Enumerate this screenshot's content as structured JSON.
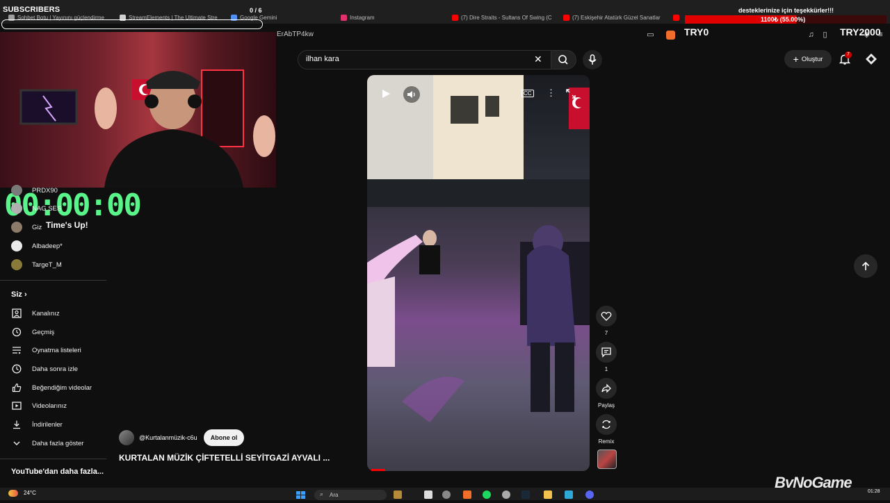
{
  "browser": {
    "tabs": [
      {
        "label": "Sohbet Botu | Yayınını güçlendirme",
        "color": "#9e9e9e"
      },
      {
        "label": "StreamElements | The Ultimate Stre",
        "color": "#cfcfcf"
      },
      {
        "label": "Google Gemini",
        "color": "#4f8ff7"
      },
      {
        "label": "Instagram",
        "color": "#e1306c"
      },
      {
        "label": "(7) Dire Straits - Sultans Of Swing (C",
        "color": "#ff0000"
      },
      {
        "label": "(7) Eskişehir Atatürk Güzel Sanatlar",
        "color": "#ff0000"
      },
      {
        "label": "",
        "color": "#ff0000"
      }
    ],
    "url_fragment": "ErAbTP4kw"
  },
  "overlays": {
    "subscribers_label": "SUBSCRIBERS",
    "subscribers_count": "0 / 6",
    "subscribers_progress": 0,
    "donation_message": "desteklerinize için teşekkürler!!!",
    "donation_amount": "1100₺ (55.00%)",
    "donation_progress": 0.55,
    "goal_start": "TRY0",
    "goal_end": "TRY2000",
    "timer": "00:00:00",
    "timer_message": "Time's Up!"
  },
  "sidebar": {
    "subscriptions": [
      {
        "label": "PRDX90",
        "color": "#7a7a7a"
      },
      {
        "label": "NAG SES",
        "color": "#b0b0b0"
      },
      {
        "label": "Giz",
        "color": "#8d7b6a"
      },
      {
        "label": "Albadeep*",
        "color": "#e9e9e9"
      },
      {
        "label": "TargeT_M",
        "color": "#8a7a3a"
      }
    ],
    "you_heading": "Siz",
    "you_items": [
      {
        "label": "Kanalınız",
        "icon": "channel-icon"
      },
      {
        "label": "Geçmiş",
        "icon": "history-icon"
      },
      {
        "label": "Oynatma listeleri",
        "icon": "playlist-icon"
      },
      {
        "label": "Daha sonra izle",
        "icon": "clock-icon"
      },
      {
        "label": "Beğendiğim videolar",
        "icon": "thumbs-up-icon"
      },
      {
        "label": "Videolarınız",
        "icon": "video-icon"
      },
      {
        "label": "İndirilenler",
        "icon": "download-icon"
      },
      {
        "label": "Daha fazla göster",
        "icon": "chevron-down-icon"
      }
    ],
    "more_heading": "YouTube'dan daha fazla..."
  },
  "header": {
    "search_value": "ilhan kara",
    "create_label": "Oluştur",
    "notification_count": "7"
  },
  "short": {
    "channel": "@Kurtalanmüzik-c6u",
    "subscribe_label": "Abone ol",
    "title": "KURTALAN MÜZİK ÇİFTETELLİ SEYİTGAZİ AYVALI ...",
    "like_count": "7",
    "comment_count": "1",
    "share_label": "Paylaş",
    "remix_label": "Remix"
  },
  "taskbar": {
    "temperature": "24°C",
    "search_placeholder": "Ara",
    "time": "01:28"
  },
  "watermark": "ByNoGame",
  "colors": {
    "accent_red": "#ff0000",
    "timer_green": "#5af58a",
    "background": "#0f0f0f"
  }
}
